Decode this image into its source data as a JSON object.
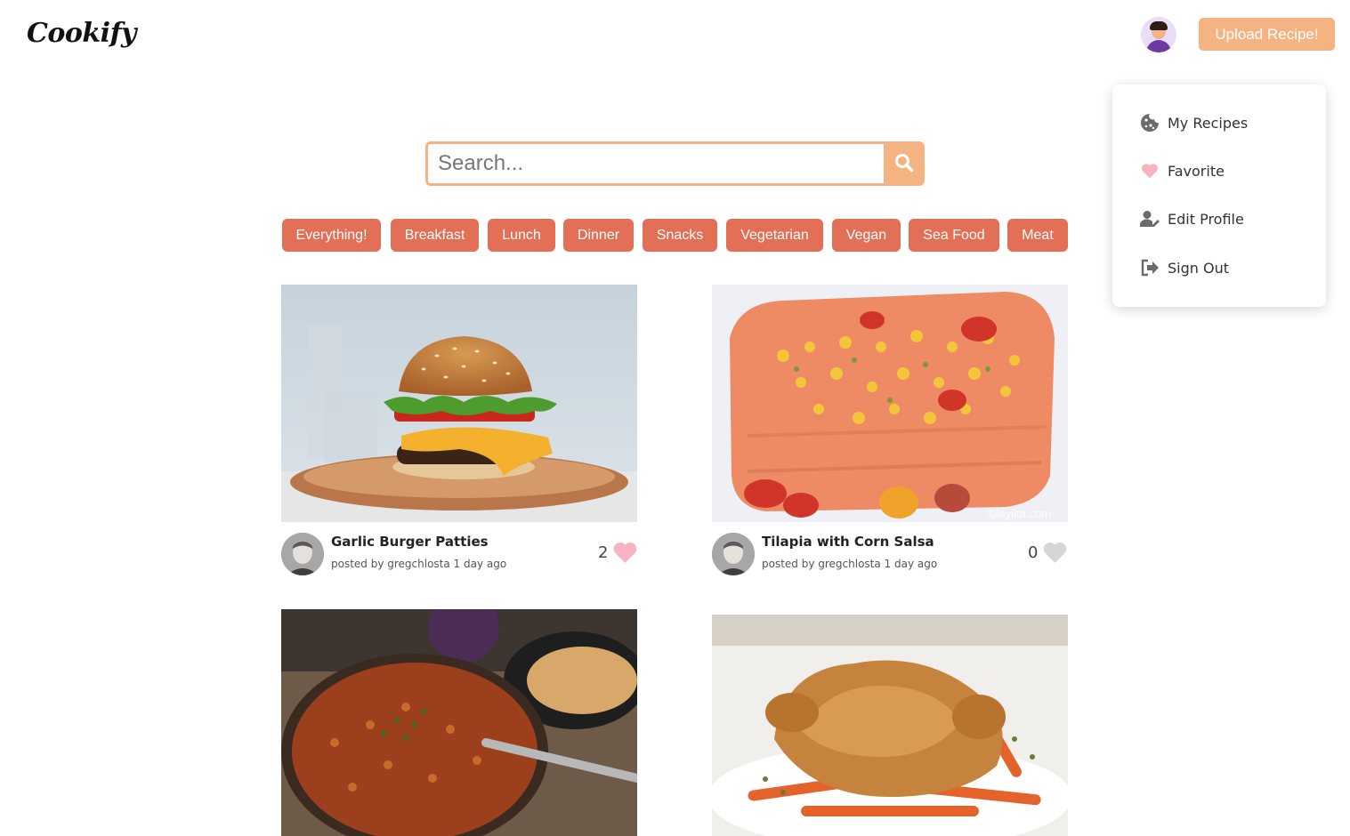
{
  "header": {
    "logo": "Cookify",
    "upload_label": "Upload Recipe!"
  },
  "user_menu": {
    "items": [
      {
        "label": "My Recipes",
        "icon": "cookie-icon"
      },
      {
        "label": "Favorite",
        "icon": "heart-icon"
      },
      {
        "label": "Edit Profile",
        "icon": "user-edit-icon"
      },
      {
        "label": "Sign Out",
        "icon": "sign-out-icon"
      }
    ]
  },
  "search": {
    "placeholder": "Search..."
  },
  "categories": [
    "Everything!",
    "Breakfast",
    "Lunch",
    "Dinner",
    "Snacks",
    "Vegetarian",
    "Vegan",
    "Sea Food",
    "Meat"
  ],
  "recipes": [
    {
      "title": "Garlic Burger Patties",
      "meta": "posted by gregchlosta 1 day ago",
      "likes": "2",
      "liked": true
    },
    {
      "title": "Tilapia with Corn Salsa",
      "meta": "posted by gregchlosta 1 day ago",
      "likes": "0",
      "liked": false,
      "watermark": "©laylita.com"
    },
    {
      "title": "",
      "meta": "",
      "likes": ""
    },
    {
      "title": "",
      "meta": "",
      "likes": ""
    }
  ],
  "colors": {
    "accent": "#f5b382",
    "category": "#e36f56",
    "heart_liked": "#f9b3c0",
    "heart_unliked": "#d6d6d6"
  }
}
